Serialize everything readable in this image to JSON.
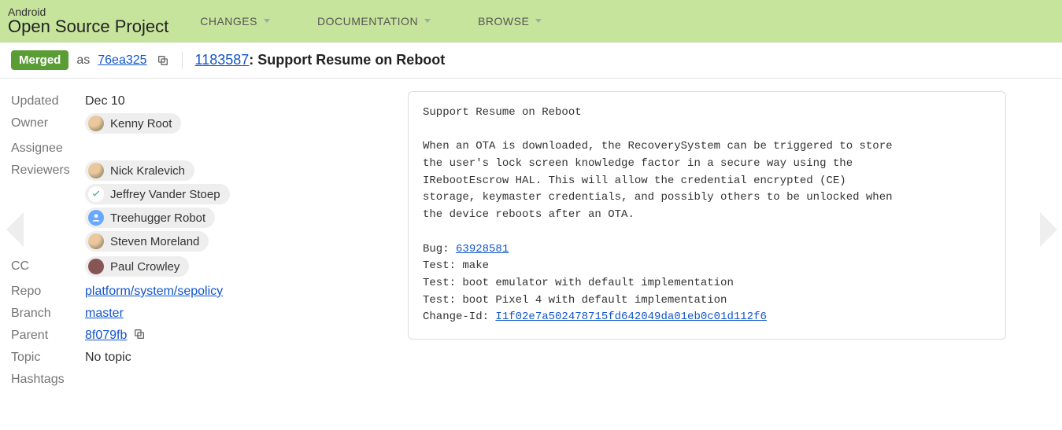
{
  "header": {
    "brand_top": "Android",
    "brand_bottom": "Open Source Project",
    "nav": [
      "CHANGES",
      "DOCUMENTATION",
      "BROWSE"
    ]
  },
  "subheader": {
    "status": "Merged",
    "as": "as",
    "commit_short": "76ea325",
    "change_number": "1183587",
    "change_title": "Support Resume on Reboot"
  },
  "meta": {
    "updated_label": "Updated",
    "updated_value": "Dec 10",
    "owner_label": "Owner",
    "owner_name": "Kenny Root",
    "assignee_label": "Assignee",
    "reviewers_label": "Reviewers",
    "reviewers": [
      "Nick Kralevich",
      "Jeffrey Vander Stoep",
      "Treehugger Robot",
      "Steven Moreland"
    ],
    "cc_label": "CC",
    "cc": [
      "Paul Crowley"
    ],
    "repo_label": "Repo",
    "repo_value": "platform/system/sepolicy",
    "branch_label": "Branch",
    "branch_value": "master",
    "parent_label": "Parent",
    "parent_value": "8f079fb",
    "topic_label": "Topic",
    "topic_value": "No topic",
    "hashtags_label": "Hashtags"
  },
  "msg": {
    "title": "Support Resume on Reboot",
    "body": "When an OTA is downloaded, the RecoverySystem can be triggered to store\nthe user's lock screen knowledge factor in a secure way using the\nIRebootEscrow HAL. This will allow the credential encrypted (CE)\nstorage, keymaster credentials, and possibly others to be unlocked when\nthe device reboots after an OTA.",
    "bug_label": "Bug: ",
    "bug_id": "63928581",
    "tests": "Test: make\nTest: boot emulator with default implementation\nTest: boot Pixel 4 with default implementation",
    "changeid_label": "Change-Id: ",
    "changeid": "I1f02e7a502478715fd642049da01eb0c01d112f6"
  }
}
